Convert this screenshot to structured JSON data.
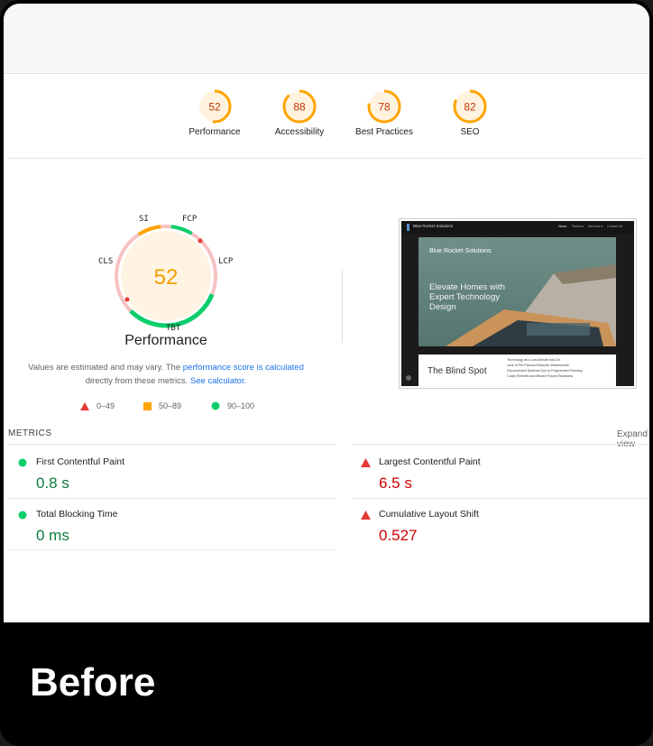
{
  "categories": [
    {
      "score": "52",
      "label": "Performance",
      "fraction": 0.52,
      "status": "average"
    },
    {
      "score": "88",
      "label": "Accessibility",
      "fraction": 0.88,
      "status": "average"
    },
    {
      "score": "78",
      "label": "Best Practices",
      "fraction": 0.78,
      "status": "average"
    },
    {
      "score": "82",
      "label": "SEO",
      "fraction": 0.82,
      "status": "average"
    }
  ],
  "gauge": {
    "score": "52",
    "title": "Performance",
    "labels": {
      "si": "SI",
      "fcp": "FCP",
      "lcp": "LCP",
      "tbt": "TBT",
      "cls": "CLS"
    }
  },
  "note": {
    "text1": "Values are estimated and may vary. The ",
    "link1": "performance score is calculated",
    "text2": "directly from these metrics. ",
    "link2": "See calculator."
  },
  "legend": {
    "fail": "0–49",
    "average": "50–89",
    "pass": "90–100"
  },
  "screenshot": {
    "brand": "Blue Rocket Solutions",
    "nav": [
      "Home",
      "Partners",
      "Services ▾",
      "Contact Us"
    ],
    "hero_brand": "Blue Rocket Solutions",
    "hero_headline": "Elevate Homes with Expert Technology Design",
    "blind_spot_title": "The Blind Spot",
    "blind_spot_lines": [
      "Technology as a Last-Minute Add-On",
      "Lack of Pre-Planned Network Infrastructure",
      "Disconnected Systems Due to Fragmented Planning",
      "Costly Retrofits and Missed Future-Readiness"
    ]
  },
  "metrics": {
    "header": "METRICS",
    "expand": "Expand view",
    "items": [
      {
        "name": "First Contentful Paint",
        "value": "0.8 s",
        "status": "pass"
      },
      {
        "name": "Largest Contentful Paint",
        "value": "6.5 s",
        "status": "fail"
      },
      {
        "name": "Total Blocking Time",
        "value": "0 ms",
        "status": "pass"
      },
      {
        "name": "Cumulative Layout Shift",
        "value": "0.527",
        "status": "fail"
      }
    ]
  },
  "caption": "Before",
  "colors": {
    "pass": "#0cce6b",
    "average": "#ffa400",
    "fail": "#ff4e42",
    "avg_text": "#c33300",
    "pass_text": "#0c7a3e",
    "fail_text": "#cc0000"
  }
}
